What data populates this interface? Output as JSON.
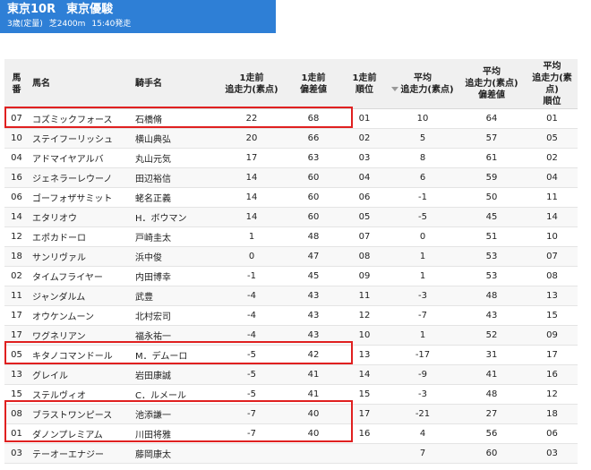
{
  "race": {
    "title_race": "東京10R",
    "title_name": "東京優駿",
    "condition": "3歳(定量)",
    "course": "芝2400m",
    "start": "15:40発走"
  },
  "table": {
    "headers": {
      "umaban_1": "馬",
      "umaban_2": "番",
      "horse": "馬名",
      "jockey": "騎手名",
      "prev_power_1": "1走前",
      "prev_power_2": "追走力(素点)",
      "prev_dev_1": "1走前",
      "prev_dev_2": "偏差値",
      "prev_rank_1": "1走前",
      "prev_rank_2": "順位",
      "avg_power_1": "平均",
      "avg_power_2": "追走力(素点)",
      "avg_dev_1": "平均",
      "avg_dev_2": "追走力(素点)",
      "avg_dev_3": "偏差値",
      "avg_rank_1": "平均",
      "avg_rank_2": "追走力(素点)",
      "avg_rank_3": "順位"
    },
    "rows": [
      {
        "no": "07",
        "horse": "コズミックフォース",
        "jockey": "石橋脩",
        "p1": "22",
        "d1": "68",
        "r1": "01",
        "pa": "10",
        "da": "64",
        "ra": "01"
      },
      {
        "no": "10",
        "horse": "ステイフーリッシュ",
        "jockey": "横山典弘",
        "p1": "20",
        "d1": "66",
        "r1": "02",
        "pa": "5",
        "da": "57",
        "ra": "05"
      },
      {
        "no": "04",
        "horse": "アドマイヤアルバ",
        "jockey": "丸山元気",
        "p1": "17",
        "d1": "63",
        "r1": "03",
        "pa": "8",
        "da": "61",
        "ra": "02"
      },
      {
        "no": "16",
        "horse": "ジェネラーレウーノ",
        "jockey": "田辺裕信",
        "p1": "14",
        "d1": "60",
        "r1": "04",
        "pa": "6",
        "da": "59",
        "ra": "04"
      },
      {
        "no": "06",
        "horse": "ゴーフォザサミット",
        "jockey": "蛯名正義",
        "p1": "14",
        "d1": "60",
        "r1": "06",
        "pa": "-1",
        "da": "50",
        "ra": "11"
      },
      {
        "no": "14",
        "horse": "エタリオウ",
        "jockey": "H．ボウマン",
        "p1": "14",
        "d1": "60",
        "r1": "05",
        "pa": "-5",
        "da": "45",
        "ra": "14"
      },
      {
        "no": "12",
        "horse": "エポカドーロ",
        "jockey": "戸崎圭太",
        "p1": "1",
        "d1": "48",
        "r1": "07",
        "pa": "0",
        "da": "51",
        "ra": "10"
      },
      {
        "no": "18",
        "horse": "サンリヴァル",
        "jockey": "浜中俊",
        "p1": "0",
        "d1": "47",
        "r1": "08",
        "pa": "1",
        "da": "53",
        "ra": "07"
      },
      {
        "no": "02",
        "horse": "タイムフライヤー",
        "jockey": "内田博幸",
        "p1": "-1",
        "d1": "45",
        "r1": "09",
        "pa": "1",
        "da": "53",
        "ra": "08"
      },
      {
        "no": "11",
        "horse": "ジャンダルム",
        "jockey": "武豊",
        "p1": "-4",
        "d1": "43",
        "r1": "11",
        "pa": "-3",
        "da": "48",
        "ra": "13"
      },
      {
        "no": "17",
        "horse": "オウケンムーン",
        "jockey": "北村宏司",
        "p1": "-4",
        "d1": "43",
        "r1": "12",
        "pa": "-7",
        "da": "43",
        "ra": "15"
      },
      {
        "no": "17",
        "horse": "ワグネリアン",
        "jockey": "福永祐一",
        "p1": "-4",
        "d1": "43",
        "r1": "10",
        "pa": "1",
        "da": "52",
        "ra": "09"
      },
      {
        "no": "05",
        "horse": "キタノコマンドール",
        "jockey": "M．デムーロ",
        "p1": "-5",
        "d1": "42",
        "r1": "13",
        "pa": "-17",
        "da": "31",
        "ra": "17"
      },
      {
        "no": "13",
        "horse": "グレイル",
        "jockey": "岩田康誠",
        "p1": "-5",
        "d1": "41",
        "r1": "14",
        "pa": "-9",
        "da": "41",
        "ra": "16"
      },
      {
        "no": "15",
        "horse": "ステルヴィオ",
        "jockey": "C．ルメール",
        "p1": "-5",
        "d1": "41",
        "r1": "15",
        "pa": "-3",
        "da": "48",
        "ra": "12"
      },
      {
        "no": "08",
        "horse": "ブラストワンピース",
        "jockey": "池添謙一",
        "p1": "-7",
        "d1": "40",
        "r1": "17",
        "pa": "-21",
        "da": "27",
        "ra": "18"
      },
      {
        "no": "01",
        "horse": "ダノンプレミアム",
        "jockey": "川田将雅",
        "p1": "-7",
        "d1": "40",
        "r1": "16",
        "pa": "4",
        "da": "56",
        "ra": "06"
      },
      {
        "no": "03",
        "horse": "テーオーエナジー",
        "jockey": "藤岡康太",
        "p1": "",
        "d1": "",
        "r1": "",
        "pa": "7",
        "da": "60",
        "ra": "03"
      }
    ]
  },
  "highlight_color": "#e02020",
  "header_color": "#2e7fd6"
}
